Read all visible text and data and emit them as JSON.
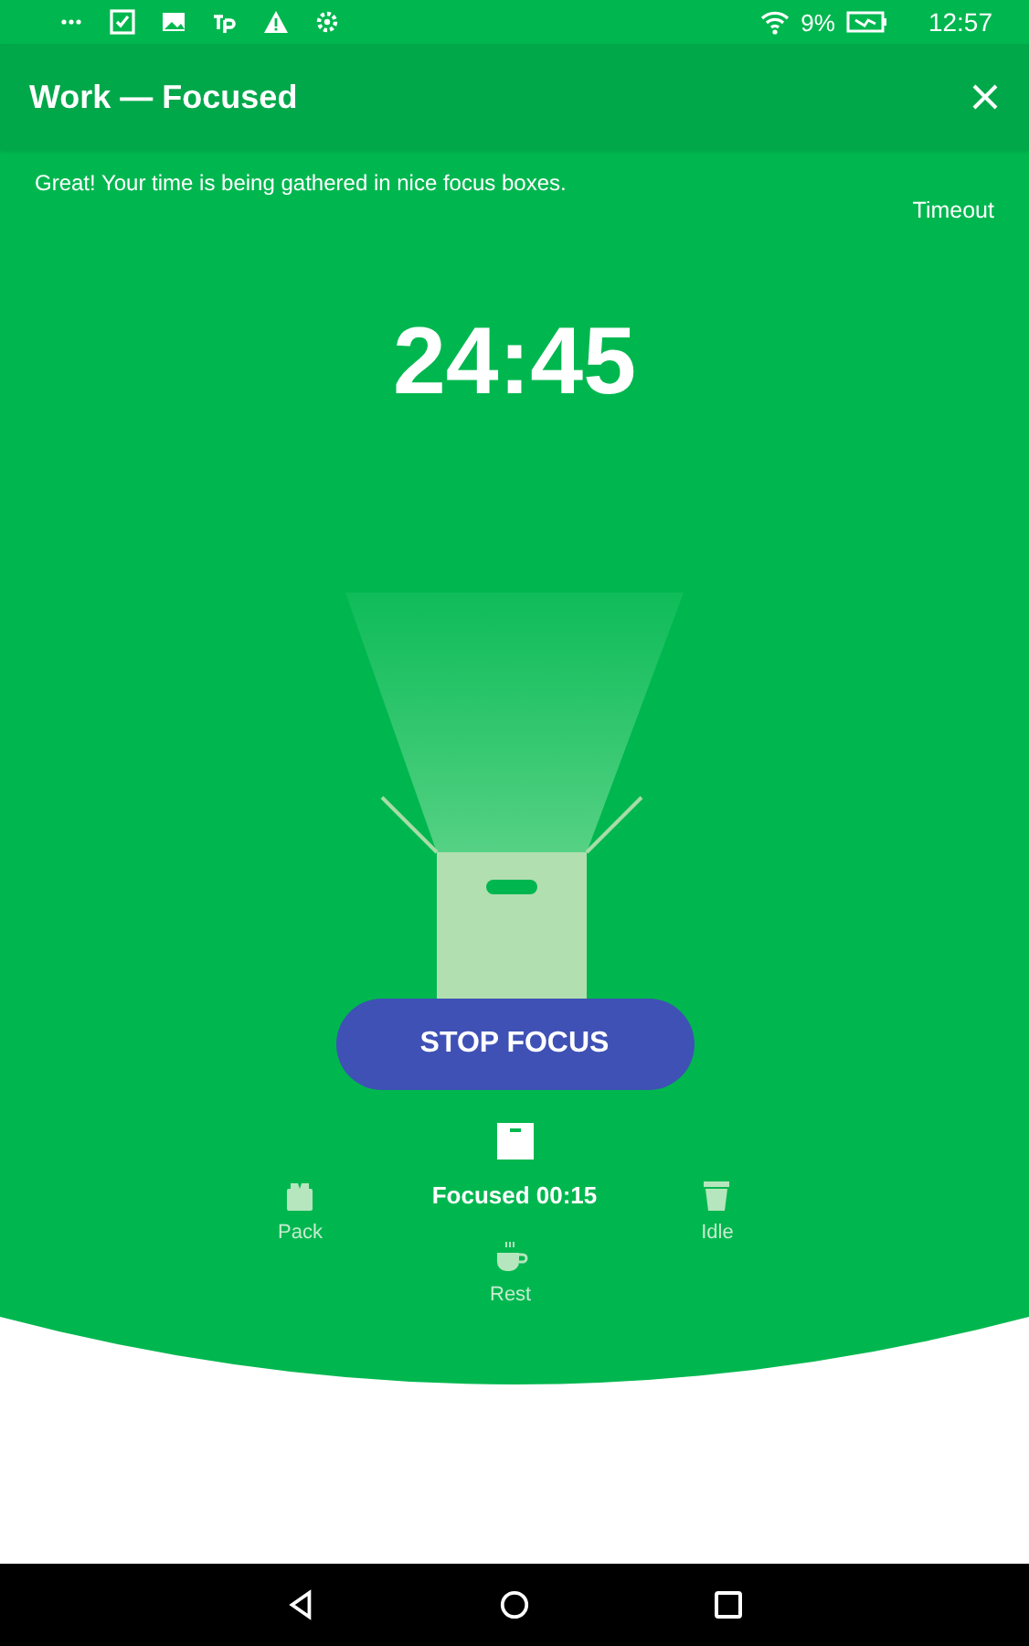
{
  "status_bar": {
    "battery": "9%",
    "time": "12:57"
  },
  "app_bar": {
    "title": "Work — Focused"
  },
  "message": "Great! Your time is being gathered in nice focus boxes.",
  "timeout_link": "Timeout",
  "timer": "24:45",
  "stop_button": "STOP FOCUS",
  "current": {
    "label": "Focused 00:15"
  },
  "modes": [
    {
      "label": "Pack",
      "kind": "pack"
    },
    {
      "label": "Idle",
      "kind": "idle"
    },
    {
      "label": "Rest",
      "kind": "rest"
    }
  ]
}
